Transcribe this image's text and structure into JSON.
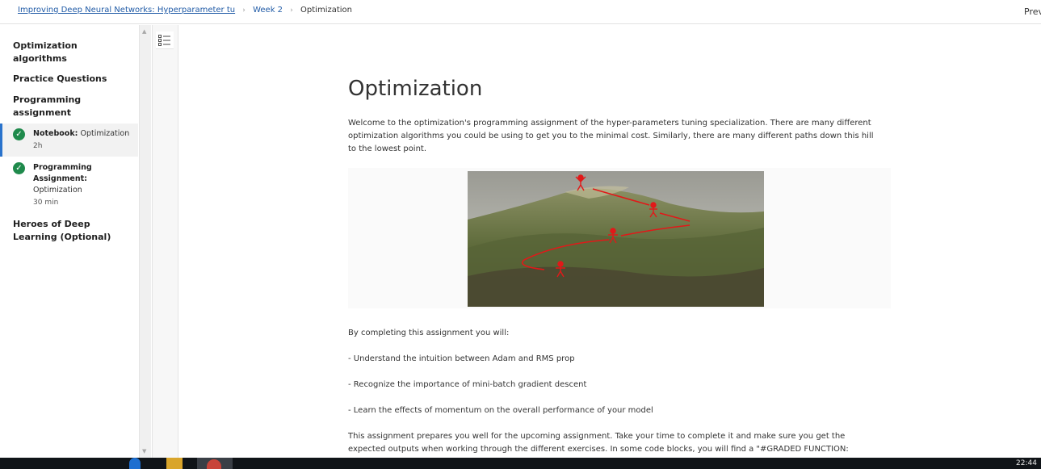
{
  "breadcrumb": {
    "course": "Improving Deep Neural Networks: Hyperparameter tu",
    "week": "Week 2",
    "current": "Optimization"
  },
  "nav": {
    "previous_label": "Prev"
  },
  "sidebar": {
    "sections": [
      "Optimization algorithms",
      "Practice Questions",
      "Programming assignment",
      "Heroes of Deep Learning (Optional)"
    ],
    "items": [
      {
        "kind": "Notebook:",
        "name": "Optimization",
        "duration": "2h",
        "completed": true,
        "active": true
      },
      {
        "kind": "Programming Assignment:",
        "name": "Optimization",
        "duration": "30 min",
        "completed": true,
        "active": false
      }
    ]
  },
  "content": {
    "title": "Optimization",
    "intro": "Welcome to the optimization's programming assignment of the hyper-parameters tuning specialization. There are many different optimization algorithms you could be using to get you to the minimal cost. Similarly, there are many different paths down this hill to the lowest point.",
    "lead": "By completing this assignment you will:",
    "goals": [
      "- Understand the intuition between Adam and RMS prop",
      "- Recognize the importance of mini-batch gradient descent",
      "- Learn the effects of momentum on the overall performance of your model"
    ],
    "outro": "This assignment prepares you well for the upcoming assignment. Take your time to complete it and make sure you get the expected outputs when working through the different exercises. In some code blocks, you will find a \"#GRADED FUNCTION:"
  },
  "taskbar": {
    "clock": "22:44"
  },
  "colors": {
    "link": "#1f5aa6",
    "check": "#1f8a4c",
    "accent": "#2a73cc",
    "path": "#e11919"
  }
}
